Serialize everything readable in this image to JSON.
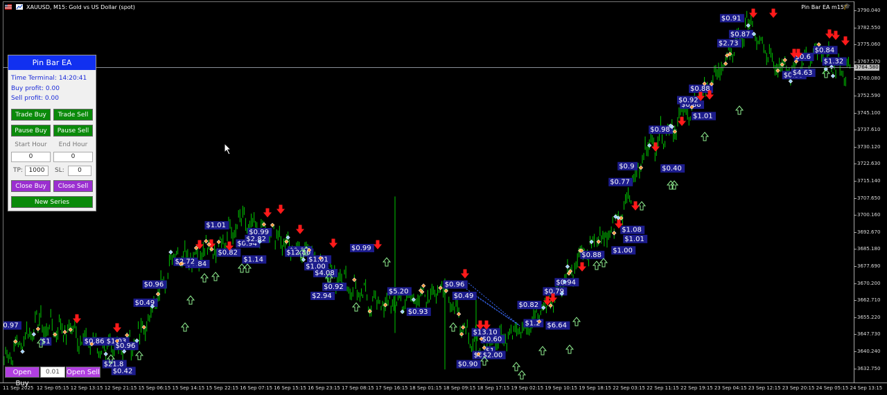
{
  "window": {
    "symbol_title": "XAUUSD, M15:  Gold vs US Dollar (spot)",
    "ea_title": "Pin Bar EA m15",
    "current_price": "3764.580"
  },
  "price_scale": [
    "3790.040",
    "3782.550",
    "3775.060",
    "3767.570",
    "3760.080",
    "3752.590",
    "3745.100",
    "3737.610",
    "3730.120",
    "3722.630",
    "3715.140",
    "3707.650",
    "3700.160",
    "3692.670",
    "3685.180",
    "3677.690",
    "3670.200",
    "3662.710",
    "3655.220",
    "3647.730",
    "3640.240",
    "3632.750"
  ],
  "time_scale": [
    "11 Sep 2025",
    "12 Sep 05:15",
    "12 Sep 13:15",
    "12 Sep 21:15",
    "15 Sep 06:15",
    "15 Sep 14:15",
    "15 Sep 22:15",
    "16 Sep 07:15",
    "16 Sep 15:15",
    "16 Sep 23:15",
    "17 Sep 08:15",
    "17 Sep 16:15",
    "18 Sep 01:15",
    "18 Sep 09:15",
    "18 Sep 17:15",
    "19 Sep 02:15",
    "19 Sep 10:15",
    "19 Sep 18:15",
    "22 Sep 03:15",
    "22 Sep 11:15",
    "22 Sep 19:15",
    "23 Sep 04:15",
    "23 Sep 12:15",
    "23 Sep 20:15",
    "24 Sep 05:15",
    "24 Sep 13:15"
  ],
  "panel": {
    "title": "Pin Bar EA",
    "time_label": "Time Terminal: 14:20:41",
    "buy_profit": "Buy profit: 0.00",
    "sell_profit": "Sell profit: 0.00",
    "trade_buy": "Trade Buy",
    "trade_sell": "Trade Sell",
    "pause_buy": "Pause Buy",
    "pause_sell": "Pause Sell",
    "start_hour_label": "Start Hour",
    "end_hour_label": "End Hour",
    "start_hour_value": "0",
    "end_hour_value": "0",
    "tp_label": "TP:",
    "tp_value": "1000",
    "sl_label": "SL:",
    "sl_value": "0",
    "close_buy": "Close Buy",
    "close_sell": "Close Sell",
    "new_series": "New Series"
  },
  "bottom_bar": {
    "open_buy": "Open Buy",
    "lot_value": "0.01",
    "open_sell": "Open Sell"
  },
  "colors": {
    "candle": "#00c800",
    "profit_label_bg": "#1c1c8c",
    "buy_arrow": "#90ee90",
    "sell_arrow": "#ff1a1a",
    "panel_header": "#1130f0",
    "button_green": "#0a8a0a",
    "button_purple": "#9b2fd0"
  },
  "chart_data": {
    "type": "candlestick",
    "symbol": "XAUUSD",
    "timeframe": "M15",
    "ylim": [
      3627.5,
      3793
    ],
    "price_path": [
      {
        "t": "11 Sep 2025",
        "p": 3636
      },
      {
        "t": "12 Sep 05:15",
        "p": 3652
      },
      {
        "t": "12 Sep 13:15",
        "p": 3648
      },
      {
        "t": "12 Sep 21:15",
        "p": 3640
      },
      {
        "t": "15 Sep 06:15",
        "p": 3645
      },
      {
        "t": "15 Sep 14:15",
        "p": 3682
      },
      {
        "t": "15 Sep 22:15",
        "p": 3683
      },
      {
        "t": "16 Sep 07:15",
        "p": 3696
      },
      {
        "t": "16 Sep 15:15",
        "p": 3690
      },
      {
        "t": "16 Sep 23:15",
        "p": 3682
      },
      {
        "t": "17 Sep 08:15",
        "p": 3671
      },
      {
        "t": "17 Sep 16:15",
        "p": 3660
      },
      {
        "t": "18 Sep 01:15",
        "p": 3662
      },
      {
        "t": "18 Sep 09:15",
        "p": 3667
      },
      {
        "t": "18 Sep 17:15",
        "p": 3640
      },
      {
        "t": "19 Sep 02:15",
        "p": 3648
      },
      {
        "t": "19 Sep 10:15",
        "p": 3658
      },
      {
        "t": "19 Sep 18:15",
        "p": 3682
      },
      {
        "t": "22 Sep 03:15",
        "p": 3693
      },
      {
        "t": "22 Sep 11:15",
        "p": 3730
      },
      {
        "t": "22 Sep 19:15",
        "p": 3742
      },
      {
        "t": "23 Sep 04:15",
        "p": 3760
      },
      {
        "t": "23 Sep 12:15",
        "p": 3784
      },
      {
        "t": "23 Sep 20:15",
        "p": 3762
      },
      {
        "t": "24 Sep 05:15",
        "p": 3770
      },
      {
        "t": "24 Sep 13:15",
        "p": 3761
      }
    ],
    "profit_labels": [
      {
        "text": "$0.97",
        "t": "11 Sep 2025",
        "p": 3651
      },
      {
        "text": "$1",
        "t": "12 Sep 05:15",
        "p": 3644
      },
      {
        "text": "$0.86",
        "t": "12 Sep 13:15",
        "p": 3644
      },
      {
        "text": "$1.03",
        "t": "12 Sep 21:15",
        "p": 3644
      },
      {
        "text": "$0.96",
        "t": "12 Sep 21:15",
        "p": 3642
      },
      {
        "text": "$21.8",
        "t": "12 Sep 21:15",
        "p": 3634
      },
      {
        "text": "$0.42",
        "t": "12 Sep 21:15",
        "p": 3631
      },
      {
        "text": "$0.49",
        "t": "15 Sep 06:15",
        "p": 3661
      },
      {
        "text": "$0.96",
        "t": "15 Sep 06:15",
        "p": 3669
      },
      {
        "text": "$0.84",
        "t": "15 Sep 14:15",
        "p": 3678
      },
      {
        "text": "$2.72",
        "t": "15 Sep 14:15",
        "p": 3679
      },
      {
        "text": "$0.82",
        "t": "15 Sep 22:15",
        "p": 3683
      },
      {
        "text": "$1.01",
        "t": "15 Sep 22:15",
        "p": 3695
      },
      {
        "text": "$0.99",
        "t": "16 Sep 07:15",
        "p": 3692
      },
      {
        "text": "$0.94",
        "t": "16 Sep 07:15",
        "p": 3687
      },
      {
        "text": "$2.82",
        "t": "16 Sep 07:15",
        "p": 3689
      },
      {
        "text": "$0.98",
        "t": "16 Sep 15:15",
        "p": 3684
      },
      {
        "text": "$1.14",
        "t": "16 Sep 07:15",
        "p": 3680
      },
      {
        "text": "$12.80",
        "t": "16 Sep 15:15",
        "p": 3683
      },
      {
        "text": "$1.01",
        "t": "16 Sep 23:15",
        "p": 3680
      },
      {
        "text": "$0.99",
        "t": "17 Sep 08:15",
        "p": 3685
      },
      {
        "text": "$1.00",
        "t": "16 Sep 23:15",
        "p": 3677
      },
      {
        "text": "$4.08",
        "t": "16 Sep 23:15",
        "p": 3674
      },
      {
        "text": "$0.92",
        "t": "16 Sep 23:15",
        "p": 3668
      },
      {
        "text": "$2.94",
        "t": "16 Sep 23:15",
        "p": 3664
      },
      {
        "text": "$5.20",
        "t": "17 Sep 16:15",
        "p": 3666
      },
      {
        "text": "$0.96",
        "t": "18 Sep 09:15",
        "p": 3669
      },
      {
        "text": "$0.49",
        "t": "18 Sep 09:15",
        "p": 3664
      },
      {
        "text": "$0.93",
        "t": "18 Sep 01:15",
        "p": 3657
      },
      {
        "text": "$0.82",
        "t": "19 Sep 02:15",
        "p": 3660
      },
      {
        "text": "$13.10",
        "t": "18 Sep 17:15",
        "p": 3648
      },
      {
        "text": "$0.60",
        "t": "18 Sep 17:15",
        "p": 3645
      },
      {
        "text": "$1.2",
        "t": "19 Sep 02:15",
        "p": 3652
      },
      {
        "text": "$6.64",
        "t": "19 Sep 10:15",
        "p": 3651
      },
      {
        "text": "$0.94",
        "t": "19 Sep 10:15",
        "p": 3670
      },
      {
        "text": "$0.79",
        "t": "19 Sep 10:15",
        "p": 3666
      },
      {
        "text": "$1",
        "t": "18 Sep 17:15",
        "p": 3640
      },
      {
        "text": "$0.9",
        "t": "18 Sep 17:15",
        "p": 3638
      },
      {
        "text": "$2.00",
        "t": "18 Sep 17:15",
        "p": 3638
      },
      {
        "text": "$0.90",
        "t": "18 Sep 09:15",
        "p": 3634
      },
      {
        "text": "$0.88",
        "t": "19 Sep 18:15",
        "p": 3682
      },
      {
        "text": "$1.01",
        "t": "22 Sep 03:15",
        "p": 3689
      },
      {
        "text": "$1.00",
        "t": "22 Sep 03:15",
        "p": 3684
      },
      {
        "text": "$1.08",
        "t": "22 Sep 03:15",
        "p": 3693
      },
      {
        "text": "$0.77",
        "t": "22 Sep 03:15",
        "p": 3714
      },
      {
        "text": "$0.9",
        "t": "22 Sep 03:15",
        "p": 3721
      },
      {
        "text": "$0.40",
        "t": "22 Sep 11:15",
        "p": 3720
      },
      {
        "text": "$0.98",
        "t": "22 Sep 11:15",
        "p": 3737
      },
      {
        "text": "$1.01",
        "t": "22 Sep 19:15",
        "p": 3743
      },
      {
        "text": "$0.88",
        "t": "22 Sep 19:15",
        "p": 3748
      },
      {
        "text": "$0.88",
        "t": "22 Sep 19:15",
        "p": 3755
      },
      {
        "text": "$0.92",
        "t": "22 Sep 19:15",
        "p": 3750
      },
      {
        "text": "$0.91",
        "t": "23 Sep 04:15",
        "p": 3786
      },
      {
        "text": "$0.87",
        "t": "23 Sep 04:15",
        "p": 3779
      },
      {
        "text": "$2.73",
        "t": "23 Sep 04:15",
        "p": 3775
      },
      {
        "text": "$0.6",
        "t": "23 Sep 20:15",
        "p": 3769
      },
      {
        "text": "$0.59",
        "t": "23 Sep 20:15",
        "p": 3761
      },
      {
        "text": "$4.63",
        "t": "23 Sep 20:15",
        "p": 3762
      },
      {
        "text": "$0.84",
        "t": "24 Sep 05:15",
        "p": 3772
      },
      {
        "text": "$1.32",
        "t": "24 Sep 05:15",
        "p": 3767
      }
    ]
  }
}
